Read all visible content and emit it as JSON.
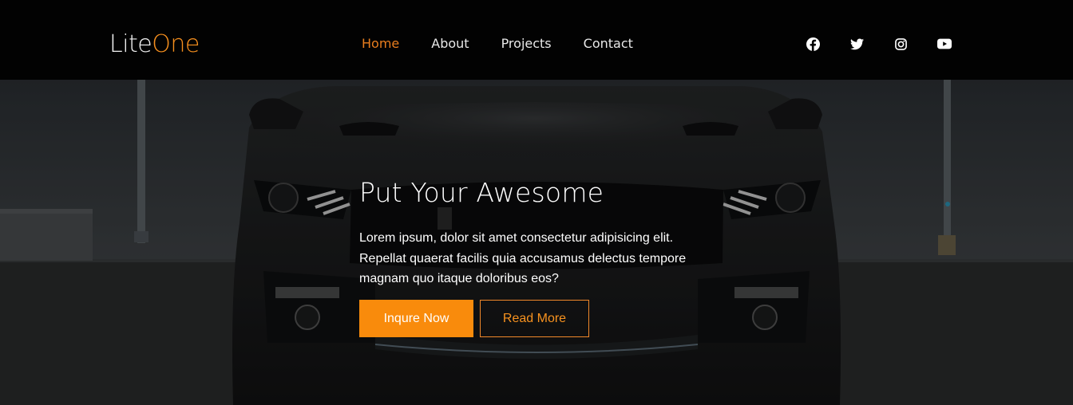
{
  "brand": {
    "name_part1": "Lite",
    "name_part2": "One",
    "accent_color": "#f7901e"
  },
  "nav": {
    "items": [
      {
        "label": "Home",
        "active": true
      },
      {
        "label": "About",
        "active": false
      },
      {
        "label": "Projects",
        "active": false
      },
      {
        "label": "Contact",
        "active": false
      }
    ]
  },
  "socials": [
    {
      "icon": "facebook-icon"
    },
    {
      "icon": "twitter-icon"
    },
    {
      "icon": "instagram-icon"
    },
    {
      "icon": "youtube-icon"
    }
  ],
  "hero": {
    "title": "Put Your Awesome",
    "text": "Lorem ipsum, dolor sit amet consectetur adipisicing elit. Repellat quaerat facilis quia accusamus delectus tempore magnam quo itaque doloribus eos?",
    "primary_button": "Inqure Now",
    "secondary_button": "Read More",
    "button_color": "#f98b0c"
  }
}
